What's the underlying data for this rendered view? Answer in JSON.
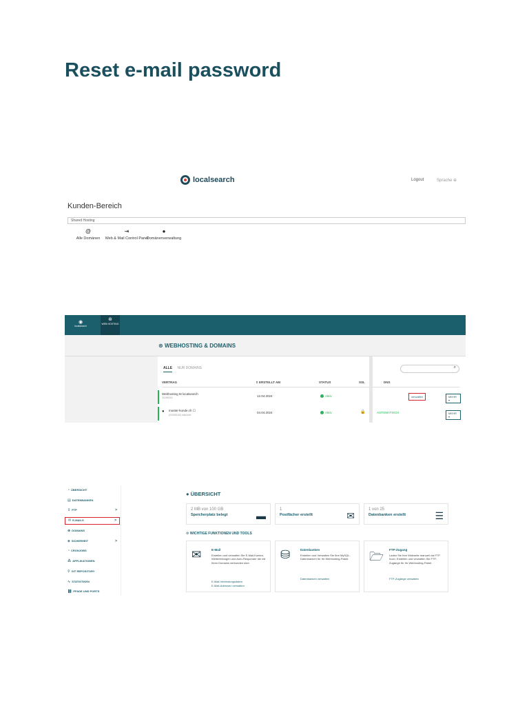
{
  "page_title": "Reset e-mail password",
  "shot1": {
    "logo": "localsearch",
    "logout": "Logout",
    "lang": "Sprache",
    "section_title": "Kunden-Bereich",
    "select_value": "Shared Hosting",
    "items": [
      {
        "icon": "@",
        "label": "Alle Domänen"
      },
      {
        "icon": "⇥",
        "label": "Web & Mail Control Panel"
      },
      {
        "icon": "●",
        "label": "Domänenverwaltung"
      }
    ]
  },
  "shot2": {
    "brand": "localsearch",
    "tab": "WEB HOSTING",
    "title": "WEBHOSTING & DOMAINS",
    "filter_all": "ALLE",
    "filter_domains": "NUR DOMAINS",
    "search_icon": "⌕",
    "cols": {
      "vertrag": "VERTRAG",
      "erstellt": "⇕ ERSTELLT AM",
      "status": "STATUS",
      "ssl": "SSL",
      "dns": "DNS"
    },
    "rows": [
      {
        "name": "Webhosting M localsearch",
        "sub": "20265163",
        "date": "12.04.2024",
        "status": "Aktiv",
        "ssl": "",
        "dns": "",
        "action": "verwalten",
        "more": "MEHR ▾"
      },
      {
        "name": "muster-kunde.ch ☐",
        "sub": "(20265163) Inklusive",
        "date": "04.04.2024",
        "status": "Aktiv",
        "ssl": "🔒",
        "dns": "AUTOMATISCH",
        "action": "",
        "more": "MEHR ▾"
      }
    ]
  },
  "shot3": {
    "nav": [
      {
        "icon": "◔",
        "label": "ÜBERSICHT"
      },
      {
        "icon": "▤",
        "label": "DATENBANKEN"
      },
      {
        "icon": "⇪",
        "label": "FTP",
        "chev": ">"
      },
      {
        "icon": "✉",
        "label": "E-MAILS",
        "chev": ">"
      },
      {
        "icon": "⊕",
        "label": "DOMAINS"
      },
      {
        "icon": "◈",
        "label": "SICHERHEIT",
        "chev": ">"
      },
      {
        "icon": "◔",
        "label": "CRONJOBS"
      },
      {
        "icon": "⁂",
        "label": "APPLIKATIONEN"
      },
      {
        "icon": "⚲",
        "label": "GIT REPOSITORY"
      },
      {
        "icon": "∿",
        "label": "STATISTIKEN"
      },
      {
        "icon": "⛓",
        "label": "PFADE UND PORTS"
      }
    ],
    "title": "ÜBERSICHT",
    "stats": [
      {
        "n": "2 MB von 100 GB",
        "l": "Speicherplatz belegt",
        "icon": "▬"
      },
      {
        "n": "1",
        "l": "Postfächer erstellt",
        "icon": "✉"
      },
      {
        "n": "1 von 25",
        "l": "Datenbanken erstellt",
        "icon": "☰"
      }
    ],
    "sub": "WICHTIGE FUNKTIONEN UND TOOLS",
    "cards": [
      {
        "icon": "✉",
        "t": "E-Mail",
        "d": "Erstellen und verwalten Sie E-Mail-Konten, Weiterleitungen und Auto-Responder die mit Ihren Domains verbunden sind.",
        "links": [
          "E-Mail-Verbindungsdaten",
          "E-Mail-Adressen verwalten"
        ]
      },
      {
        "icon": "⛁",
        "t": "Datenbanken",
        "d": "Erstellen und Verwalten Sie Ihre MySQL-Datenbanken für Ihr Webhosting-Paket.",
        "links": [
          "Datenbanken verwalten"
        ]
      },
      {
        "icon": "🗁",
        "t": "FTP-Zugang",
        "d": "Laden Sie Ihre Webseite manuell via FTP hoch. Erstellen und verwalten Sie FTP-Zugänge für Ihr Webhosting-Paket.",
        "links": [
          "FTP-Zugänge verwalten"
        ]
      }
    ]
  }
}
